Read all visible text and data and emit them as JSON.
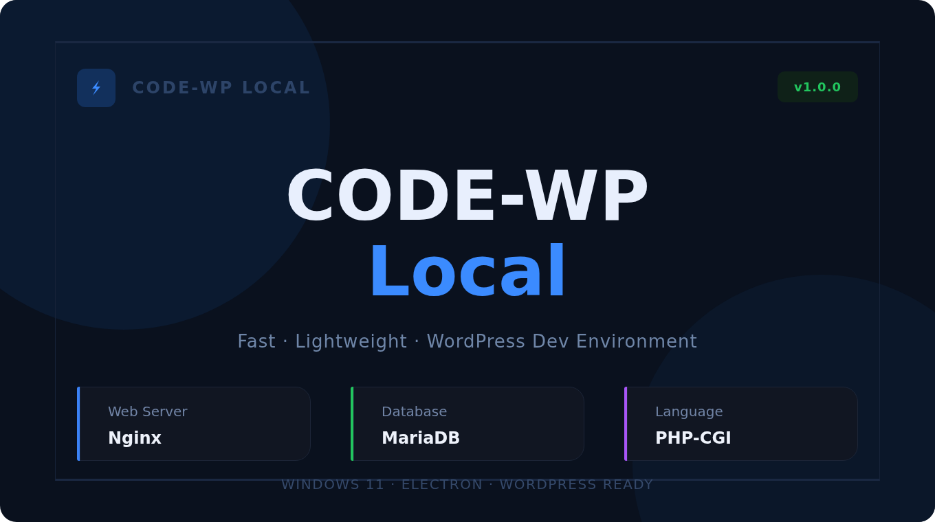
{
  "brand": {
    "name": "CODE-WP LOCAL"
  },
  "version_badge": "v1.0.0",
  "title": {
    "line_1": "CODE-WP",
    "line_2": "Local"
  },
  "tagline": "Fast · Lightweight · WordPress Dev Environment",
  "stack": [
    {
      "label": "Web Server",
      "value": "Nginx",
      "color": "#3b82f6"
    },
    {
      "label": "Database",
      "value": "MariaDB",
      "color": "#22c55e"
    },
    {
      "label": "Language",
      "value": "PHP-CGI",
      "color": "#a855f7"
    }
  ],
  "footer": "WINDOWS 11 · ELECTRON · WORDPRESS READY"
}
